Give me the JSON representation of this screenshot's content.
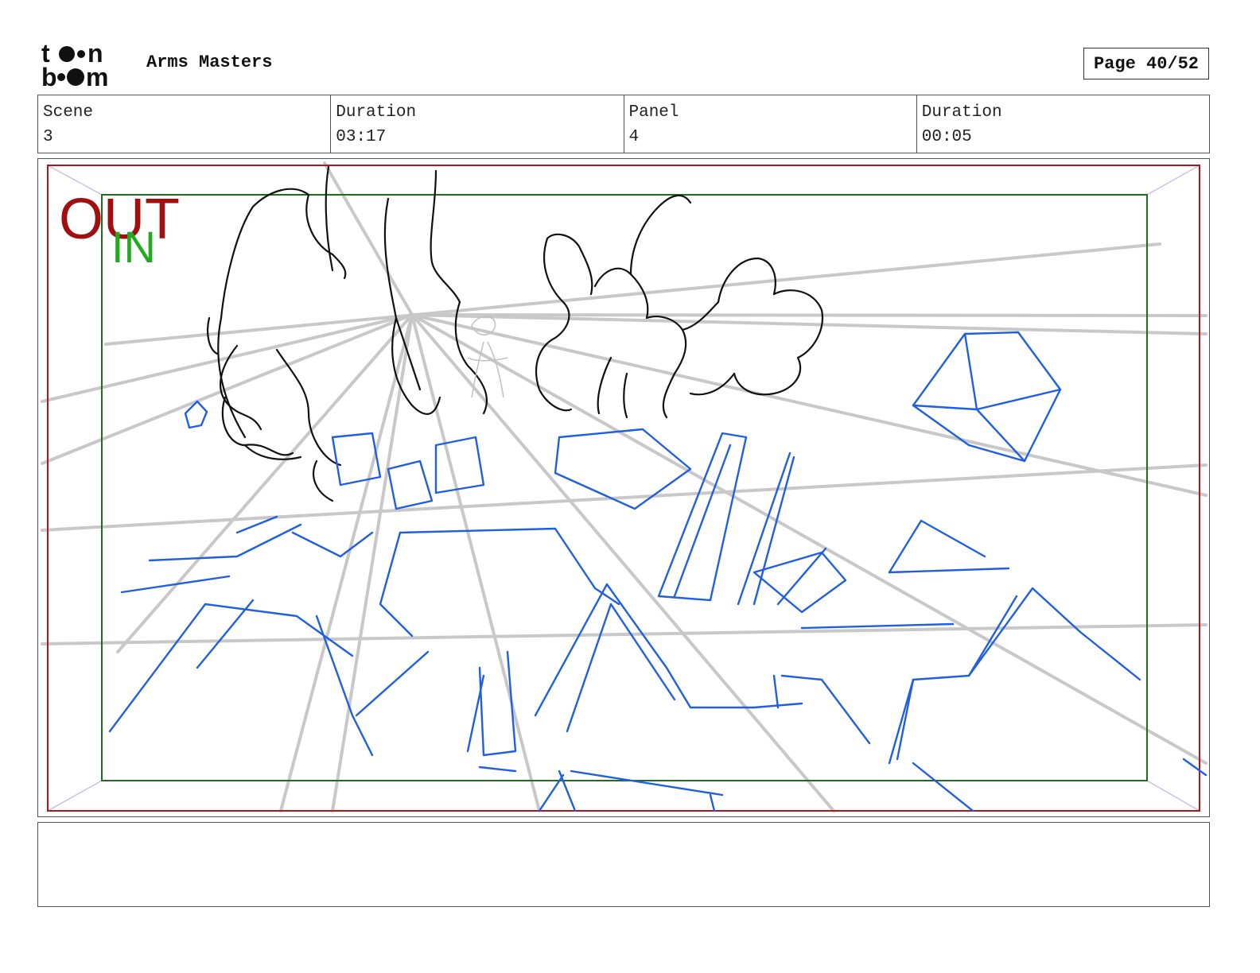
{
  "header": {
    "logo_top": "to•n",
    "logo_bottom": "b••m",
    "project_title": "Arms Masters",
    "page_label": "Page 40/52"
  },
  "info": {
    "scene_label": "Scene",
    "scene_value": "3",
    "duration_label": "Duration",
    "duration_value": "03:17",
    "panel_label": "Panel",
    "panel_value": "4",
    "panel_duration_label": "Duration",
    "panel_duration_value": "00:05"
  },
  "panel": {
    "out_label": "OUT",
    "in_label": "IN",
    "colors": {
      "out_frame": "#b01818",
      "in_frame": "#1e6e1e",
      "sketch_black": "#111111",
      "sketch_blue": "#1f5fe0",
      "guide_gray": "#c8c8c8"
    }
  },
  "notes": {
    "text": ""
  }
}
